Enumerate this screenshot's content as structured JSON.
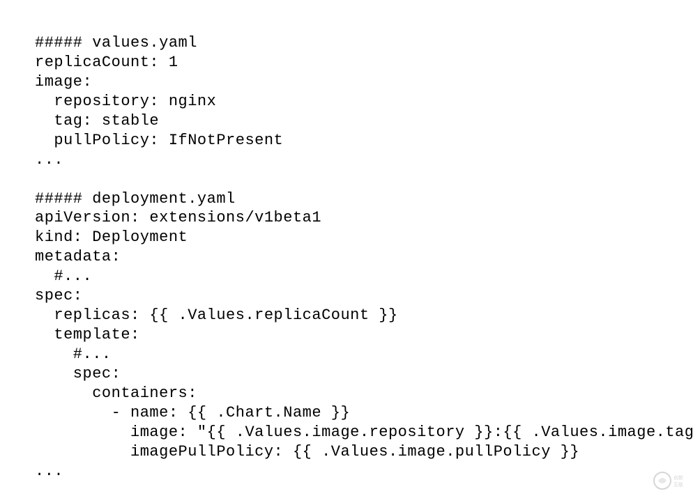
{
  "code": {
    "lines": [
      "##### values.yaml",
      "replicaCount: 1",
      "image:",
      "  repository: nginx",
      "  tag: stable",
      "  pullPolicy: IfNotPresent",
      "...",
      "",
      "##### deployment.yaml",
      "apiVersion: extensions/v1beta1",
      "kind: Deployment",
      "metadata:",
      "  #...",
      "spec:",
      "  replicas: {{ .Values.replicaCount }}",
      "  template:",
      "    #...",
      "    spec:",
      "      containers:",
      "        - name: {{ .Chart.Name }}",
      "          image: \"{{ .Values.image.repository }}:{{ .Values.image.tag }}\"",
      "          imagePullPolicy: {{ .Values.image.pullPolicy }}",
      "..."
    ]
  },
  "watermark": {
    "text": "创新互联"
  }
}
